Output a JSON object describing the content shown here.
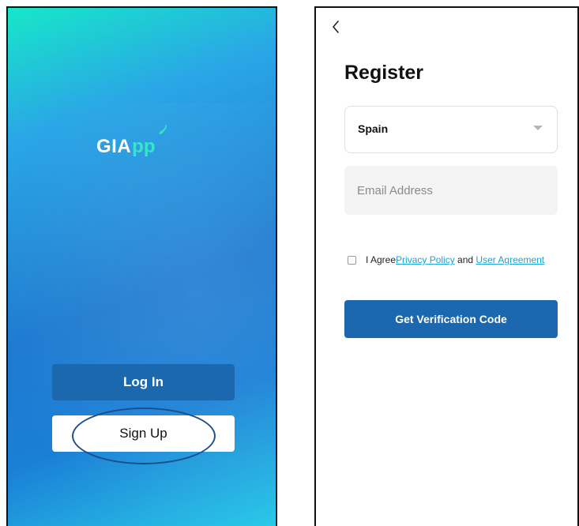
{
  "welcome": {
    "logo": {
      "main": "GIA",
      "sub": "pp"
    },
    "login_label": "Log In",
    "signup_label": "Sign Up"
  },
  "register": {
    "title": "Register",
    "country": {
      "selected": "Spain"
    },
    "email": {
      "placeholder": "Email Address",
      "value": ""
    },
    "agreement": {
      "prefix": "I Agree",
      "privacy_link": "Privacy Policy",
      "conjunction": " and ",
      "user_link": "User Agreement",
      "checked": false
    },
    "submit_label": "Get Verification Code"
  },
  "colors": {
    "primary_button": "#1b68ae",
    "gradient_top": "#17e7c8",
    "gradient_mid": "#1e7ad0",
    "link": "#1aa3d8",
    "highlight": "#1c4e8c"
  },
  "icons": {
    "back": "chevron-left-icon",
    "dropdown": "caret-down-icon",
    "logo_signal": "wifi-signal-icon"
  }
}
